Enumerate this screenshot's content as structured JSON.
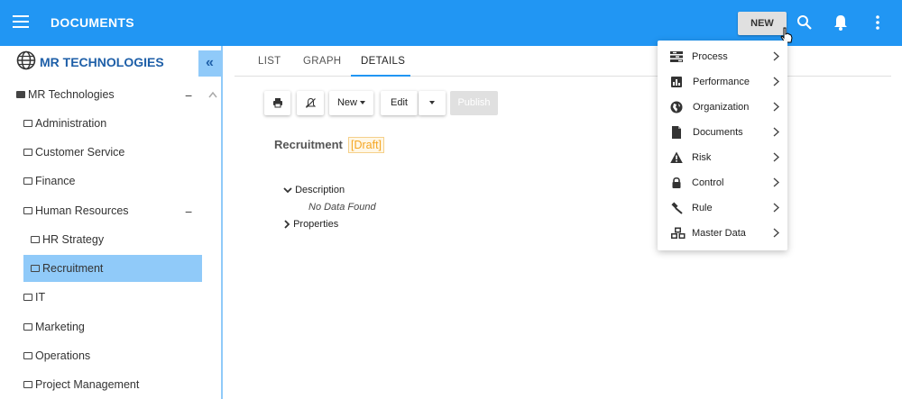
{
  "topbar": {
    "title": "DOCUMENTS",
    "new_label": "NEW",
    "icons": [
      "menu-icon",
      "search-icon",
      "bell-icon",
      "more-vert-icon"
    ],
    "color": "#2196f3"
  },
  "sidebar": {
    "org_title": "MR TECHNOLOGIES",
    "items": [
      {
        "label": "MR Technologies"
      },
      {
        "label": "Administration"
      },
      {
        "label": "Customer Service"
      },
      {
        "label": "Finance"
      },
      {
        "label": "Human Resources"
      },
      {
        "label": "HR Strategy"
      },
      {
        "label": "Recruitment"
      },
      {
        "label": "IT"
      },
      {
        "label": "Marketing"
      },
      {
        "label": "Operations"
      },
      {
        "label": "Project Management"
      }
    ],
    "selected": "Recruitment"
  },
  "tabs": [
    {
      "label": "LIST"
    },
    {
      "label": "GRAPH"
    },
    {
      "label": "DETAILS"
    }
  ],
  "active_tab": "DETAILS",
  "toolbar": {
    "new_label": "New",
    "edit_label": "Edit",
    "publish_label": "Publish"
  },
  "document": {
    "title": "Recruitment",
    "status": "[Draft]",
    "description_label": "Description",
    "no_data": "No Data Found",
    "properties_label": "Properties"
  },
  "new_menu": {
    "items": [
      {
        "label": "Process",
        "icon": "process-icon"
      },
      {
        "label": "Performance",
        "icon": "chart-icon"
      },
      {
        "label": "Organization",
        "icon": "globe-icon"
      },
      {
        "label": "Documents",
        "icon": "document-icon"
      },
      {
        "label": "Risk",
        "icon": "warning-icon"
      },
      {
        "label": "Control",
        "icon": "lock-icon"
      },
      {
        "label": "Rule",
        "icon": "gavel-icon"
      },
      {
        "label": "Master Data",
        "icon": "cubes-icon"
      }
    ]
  }
}
